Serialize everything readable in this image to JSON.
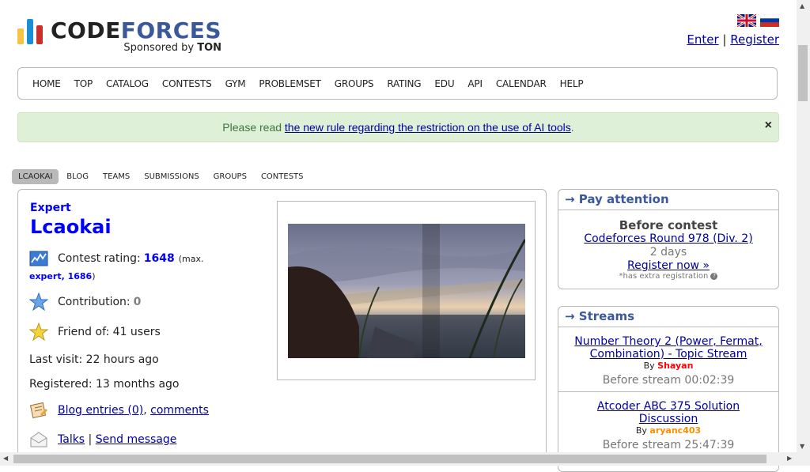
{
  "brand": {
    "title_code": "CODE",
    "title_forces": "FORCES",
    "sponsor_prefix": "Sponsored by",
    "sponsor_name": "TON",
    "bar_colors": [
      "#f6c342",
      "#1a8fd6",
      "#c9302c"
    ]
  },
  "auth": {
    "enter": "Enter",
    "separator": "|",
    "register": "Register"
  },
  "menu": [
    "HOME",
    "TOP",
    "CATALOG",
    "CONTESTS",
    "GYM",
    "PROBLEMSET",
    "GROUPS",
    "RATING",
    "EDU",
    "API",
    "CALENDAR",
    "HELP"
  ],
  "alert": {
    "prefix": "Please read ",
    "link": "the new rule regarding the restriction on the use of AI tools",
    "suffix": ".",
    "close": "×"
  },
  "second_menu": [
    "LCAOKAI",
    "BLOG",
    "TEAMS",
    "SUBMISSIONS",
    "GROUPS",
    "CONTESTS"
  ],
  "profile": {
    "rank": "Expert",
    "handle": "Lcaokai",
    "rating_label": "Contest rating: ",
    "rating": "1648",
    "max_open": "(max.",
    "max_rank": "expert, 1686",
    "max_close": ")",
    "contribution_label": "Contribution: ",
    "contribution": "0",
    "friend_of": "Friend of: 41 users",
    "last_visit": "Last visit: 22 hours ago",
    "registered": "Registered: 13 months ago",
    "blog_entries": "Blog entries (0)",
    "comments": "comments",
    "talks": "Talks",
    "send_message": "Send message",
    "sep_comma": ", ",
    "sep_bar": " | "
  },
  "pay_attention": {
    "title": "→ Pay attention",
    "heading": "Before contest",
    "contest": "Codeforces Round 978 (Div. 2)",
    "time": "2 days",
    "register": "Register now »",
    "note": "*has extra registration"
  },
  "streams": {
    "title": "→ Streams",
    "items": [
      {
        "title": "Number Theory 2 (Power, Fermat, Combination) - Topic Stream",
        "by": "By ",
        "author": "Shayan",
        "author_color": "#ff0000",
        "time": "Before stream 00:02:39"
      },
      {
        "title": "Atcoder ABC 375 Solution Discussion",
        "by": "By ",
        "author": "aryanc403",
        "author_color": "#ff8c00",
        "time": "Before stream 25:47:39"
      }
    ]
  }
}
